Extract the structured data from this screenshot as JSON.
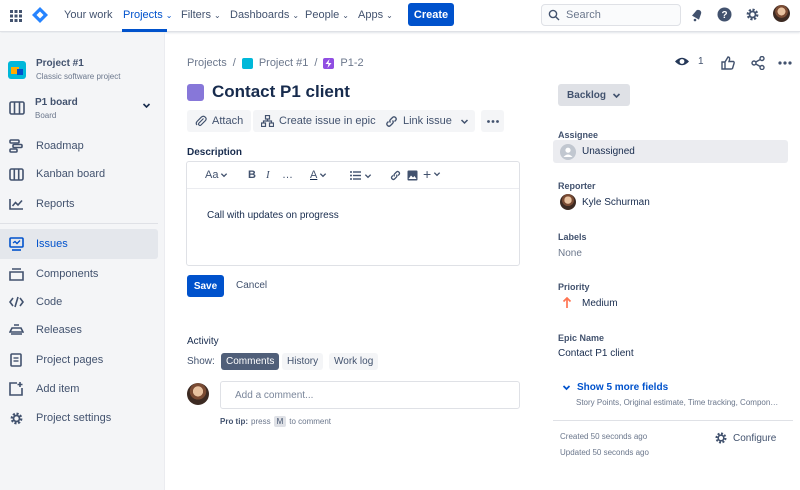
{
  "topnav": {
    "your_work": "Your work",
    "projects": "Projects",
    "filters": "Filters",
    "dashboards": "Dashboards",
    "people": "People",
    "apps": "Apps",
    "create": "Create",
    "search_placeholder": "Search"
  },
  "sidebar": {
    "project_name": "Project #1",
    "project_type": "Classic software project",
    "board_name": "P1 board",
    "board_sub": "Board",
    "items": [
      {
        "label": "Roadmap",
        "icon": "roadmap-icon"
      },
      {
        "label": "Kanban board",
        "icon": "kanban-icon"
      },
      {
        "label": "Reports",
        "icon": "reports-icon"
      },
      {
        "label": "Issues",
        "icon": "issues-icon"
      },
      {
        "label": "Components",
        "icon": "components-icon"
      },
      {
        "label": "Code",
        "icon": "code-icon"
      },
      {
        "label": "Releases",
        "icon": "releases-icon"
      },
      {
        "label": "Project pages",
        "icon": "pages-icon"
      },
      {
        "label": "Add item",
        "icon": "add-item-icon"
      },
      {
        "label": "Project settings",
        "icon": "gear-icon"
      }
    ]
  },
  "breadcrumb": {
    "projects": "Projects",
    "project": "Project #1",
    "issue_key": "P1-2"
  },
  "issue": {
    "title": "Contact P1 client",
    "watchers": "1",
    "actions": {
      "attach": "Attach",
      "create_in_epic": "Create issue in epic",
      "link_issue": "Link issue"
    },
    "description_label": "Description",
    "description_text": "Call with updates on progress",
    "editor": {
      "text_style": "Aa"
    },
    "save": "Save",
    "cancel": "Cancel"
  },
  "activity": {
    "label": "Activity",
    "show_label": "Show:",
    "tabs": [
      "Comments",
      "History",
      "Work log"
    ],
    "comment_placeholder": "Add a comment...",
    "protip_prefix": "Pro tip:",
    "protip_press": "press",
    "protip_key": "M",
    "protip_suffix": "to comment"
  },
  "details": {
    "status": "Backlog",
    "assignee_label": "Assignee",
    "assignee_value": "Unassigned",
    "reporter_label": "Reporter",
    "reporter_value": "Kyle Schurman",
    "labels_label": "Labels",
    "labels_value": "None",
    "priority_label": "Priority",
    "priority_value": "Medium",
    "epic_name_label": "Epic Name",
    "epic_name_value": "Contact P1 client",
    "more_fields": "Show 5 more fields",
    "more_fields_sub": "Story Points, Original estimate, Time tracking, Compon…",
    "created": "Created 50 seconds ago",
    "updated": "Updated 50 seconds ago",
    "configure": "Configure"
  },
  "colors": {
    "brand_blue": "#0052cc",
    "epic_purple": "#8777d9",
    "priority_orange": "#ff7452"
  }
}
